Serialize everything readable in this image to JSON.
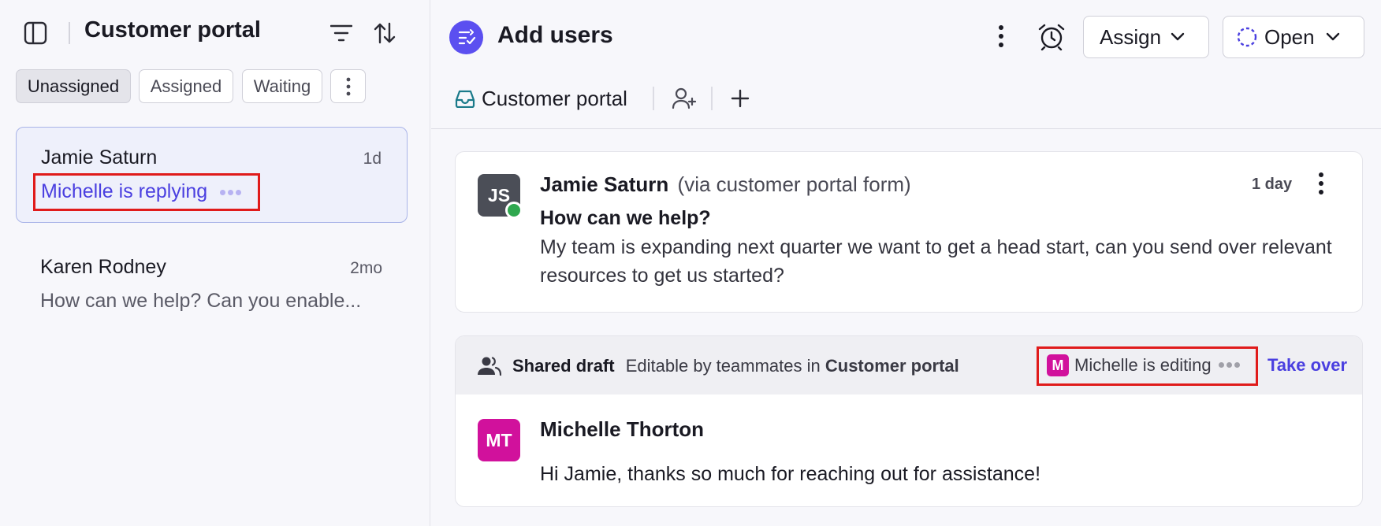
{
  "sidebar": {
    "title": "Customer portal",
    "filters": [
      {
        "label": "Unassigned",
        "active": true
      },
      {
        "label": "Assigned",
        "active": false
      },
      {
        "label": "Waiting",
        "active": false
      }
    ],
    "conversations": [
      {
        "name": "Jamie Saturn",
        "time": "1d",
        "preview": "Michelle is replying",
        "selected": true
      },
      {
        "name": "Karen Rodney",
        "time": "2mo",
        "preview": "How can we help? Can you enable...",
        "selected": false
      }
    ]
  },
  "header": {
    "title": "Add users",
    "assign_label": "Assign",
    "status_label": "Open",
    "inbox_tab_label": "Customer portal"
  },
  "message": {
    "sender": "Jamie Saturn",
    "via": "(via customer portal form)",
    "time": "1 day",
    "avatar_initials": "JS",
    "subject": "How can we help?",
    "body": "My team is expanding next quarter we want to get a head start, can you send over relevant resources to get us started?"
  },
  "draft": {
    "label": "Shared draft",
    "editable_prefix": "Editable by teammates in",
    "editable_inbox": "Customer portal",
    "editor_initial": "M",
    "editing_text": "Michelle is editing",
    "take_over_label": "Take over",
    "author": "Michelle Thorton",
    "author_initials": "MT",
    "body": "Hi Jamie, thanks so much for reaching out for assistance!"
  },
  "colors": {
    "accent": "#4a3fe0",
    "brand_icon_bg": "#5b4ff0",
    "michelle": "#d1119c",
    "online": "#2fa84f",
    "highlight": "#e01b1b"
  }
}
